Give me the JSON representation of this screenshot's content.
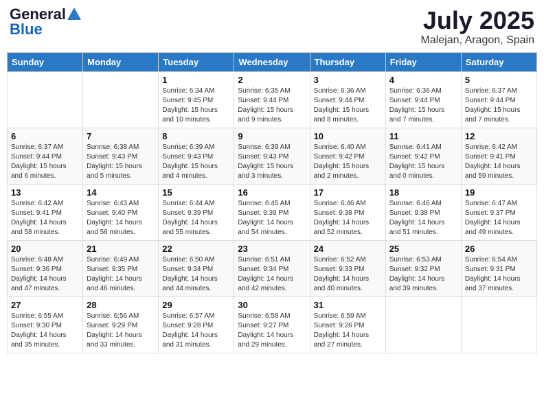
{
  "logo": {
    "general": "General",
    "blue": "Blue"
  },
  "title": {
    "month": "July 2025",
    "location": "Malejan, Aragon, Spain"
  },
  "weekdays": [
    "Sunday",
    "Monday",
    "Tuesday",
    "Wednesday",
    "Thursday",
    "Friday",
    "Saturday"
  ],
  "weeks": [
    [
      {
        "day": "",
        "info": ""
      },
      {
        "day": "",
        "info": ""
      },
      {
        "day": "1",
        "info": "Sunrise: 6:34 AM\nSunset: 9:45 PM\nDaylight: 15 hours and 10 minutes."
      },
      {
        "day": "2",
        "info": "Sunrise: 6:35 AM\nSunset: 9:44 PM\nDaylight: 15 hours and 9 minutes."
      },
      {
        "day": "3",
        "info": "Sunrise: 6:36 AM\nSunset: 9:44 PM\nDaylight: 15 hours and 8 minutes."
      },
      {
        "day": "4",
        "info": "Sunrise: 6:36 AM\nSunset: 9:44 PM\nDaylight: 15 hours and 7 minutes."
      },
      {
        "day": "5",
        "info": "Sunrise: 6:37 AM\nSunset: 9:44 PM\nDaylight: 15 hours and 7 minutes."
      }
    ],
    [
      {
        "day": "6",
        "info": "Sunrise: 6:37 AM\nSunset: 9:44 PM\nDaylight: 15 hours and 6 minutes."
      },
      {
        "day": "7",
        "info": "Sunrise: 6:38 AM\nSunset: 9:43 PM\nDaylight: 15 hours and 5 minutes."
      },
      {
        "day": "8",
        "info": "Sunrise: 6:39 AM\nSunset: 9:43 PM\nDaylight: 15 hours and 4 minutes."
      },
      {
        "day": "9",
        "info": "Sunrise: 6:39 AM\nSunset: 9:43 PM\nDaylight: 15 hours and 3 minutes."
      },
      {
        "day": "10",
        "info": "Sunrise: 6:40 AM\nSunset: 9:42 PM\nDaylight: 15 hours and 2 minutes."
      },
      {
        "day": "11",
        "info": "Sunrise: 6:41 AM\nSunset: 9:42 PM\nDaylight: 15 hours and 0 minutes."
      },
      {
        "day": "12",
        "info": "Sunrise: 6:42 AM\nSunset: 9:41 PM\nDaylight: 14 hours and 59 minutes."
      }
    ],
    [
      {
        "day": "13",
        "info": "Sunrise: 6:42 AM\nSunset: 9:41 PM\nDaylight: 14 hours and 58 minutes."
      },
      {
        "day": "14",
        "info": "Sunrise: 6:43 AM\nSunset: 9:40 PM\nDaylight: 14 hours and 56 minutes."
      },
      {
        "day": "15",
        "info": "Sunrise: 6:44 AM\nSunset: 9:39 PM\nDaylight: 14 hours and 55 minutes."
      },
      {
        "day": "16",
        "info": "Sunrise: 6:45 AM\nSunset: 9:39 PM\nDaylight: 14 hours and 54 minutes."
      },
      {
        "day": "17",
        "info": "Sunrise: 6:46 AM\nSunset: 9:38 PM\nDaylight: 14 hours and 52 minutes."
      },
      {
        "day": "18",
        "info": "Sunrise: 6:46 AM\nSunset: 9:38 PM\nDaylight: 14 hours and 51 minutes."
      },
      {
        "day": "19",
        "info": "Sunrise: 6:47 AM\nSunset: 9:37 PM\nDaylight: 14 hours and 49 minutes."
      }
    ],
    [
      {
        "day": "20",
        "info": "Sunrise: 6:48 AM\nSunset: 9:36 PM\nDaylight: 14 hours and 47 minutes."
      },
      {
        "day": "21",
        "info": "Sunrise: 6:49 AM\nSunset: 9:35 PM\nDaylight: 14 hours and 46 minutes."
      },
      {
        "day": "22",
        "info": "Sunrise: 6:50 AM\nSunset: 9:34 PM\nDaylight: 14 hours and 44 minutes."
      },
      {
        "day": "23",
        "info": "Sunrise: 6:51 AM\nSunset: 9:34 PM\nDaylight: 14 hours and 42 minutes."
      },
      {
        "day": "24",
        "info": "Sunrise: 6:52 AM\nSunset: 9:33 PM\nDaylight: 14 hours and 40 minutes."
      },
      {
        "day": "25",
        "info": "Sunrise: 6:53 AM\nSunset: 9:32 PM\nDaylight: 14 hours and 39 minutes."
      },
      {
        "day": "26",
        "info": "Sunrise: 6:54 AM\nSunset: 9:31 PM\nDaylight: 14 hours and 37 minutes."
      }
    ],
    [
      {
        "day": "27",
        "info": "Sunrise: 6:55 AM\nSunset: 9:30 PM\nDaylight: 14 hours and 35 minutes."
      },
      {
        "day": "28",
        "info": "Sunrise: 6:56 AM\nSunset: 9:29 PM\nDaylight: 14 hours and 33 minutes."
      },
      {
        "day": "29",
        "info": "Sunrise: 6:57 AM\nSunset: 9:28 PM\nDaylight: 14 hours and 31 minutes."
      },
      {
        "day": "30",
        "info": "Sunrise: 6:58 AM\nSunset: 9:27 PM\nDaylight: 14 hours and 29 minutes."
      },
      {
        "day": "31",
        "info": "Sunrise: 6:59 AM\nSunset: 9:26 PM\nDaylight: 14 hours and 27 minutes."
      },
      {
        "day": "",
        "info": ""
      },
      {
        "day": "",
        "info": ""
      }
    ]
  ]
}
